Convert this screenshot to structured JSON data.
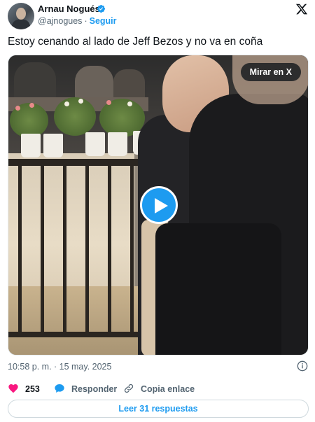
{
  "author": {
    "name": "Arnau Nogués",
    "handle": "@ajnogues",
    "separator": "·",
    "follow_label": "Seguir",
    "verified": true
  },
  "platform_icon": "x-logo-icon",
  "tweet": {
    "text": "Estoy cenando al lado de Jeff Bezos y no va en coña"
  },
  "media": {
    "type": "video",
    "watch_label": "Mirar en X",
    "play_icon": "play-icon"
  },
  "meta": {
    "timestamp": "10:58 p. m. · 15 may. 2025",
    "info_icon": "info-icon"
  },
  "actions": {
    "like_count": "253",
    "reply_label": "Responder",
    "copy_label": "Copia enlace"
  },
  "replies_button": "Leer 31 respuestas",
  "colors": {
    "accent": "#1d9bf0",
    "like": "#f91880",
    "secondary_text": "#536471"
  }
}
